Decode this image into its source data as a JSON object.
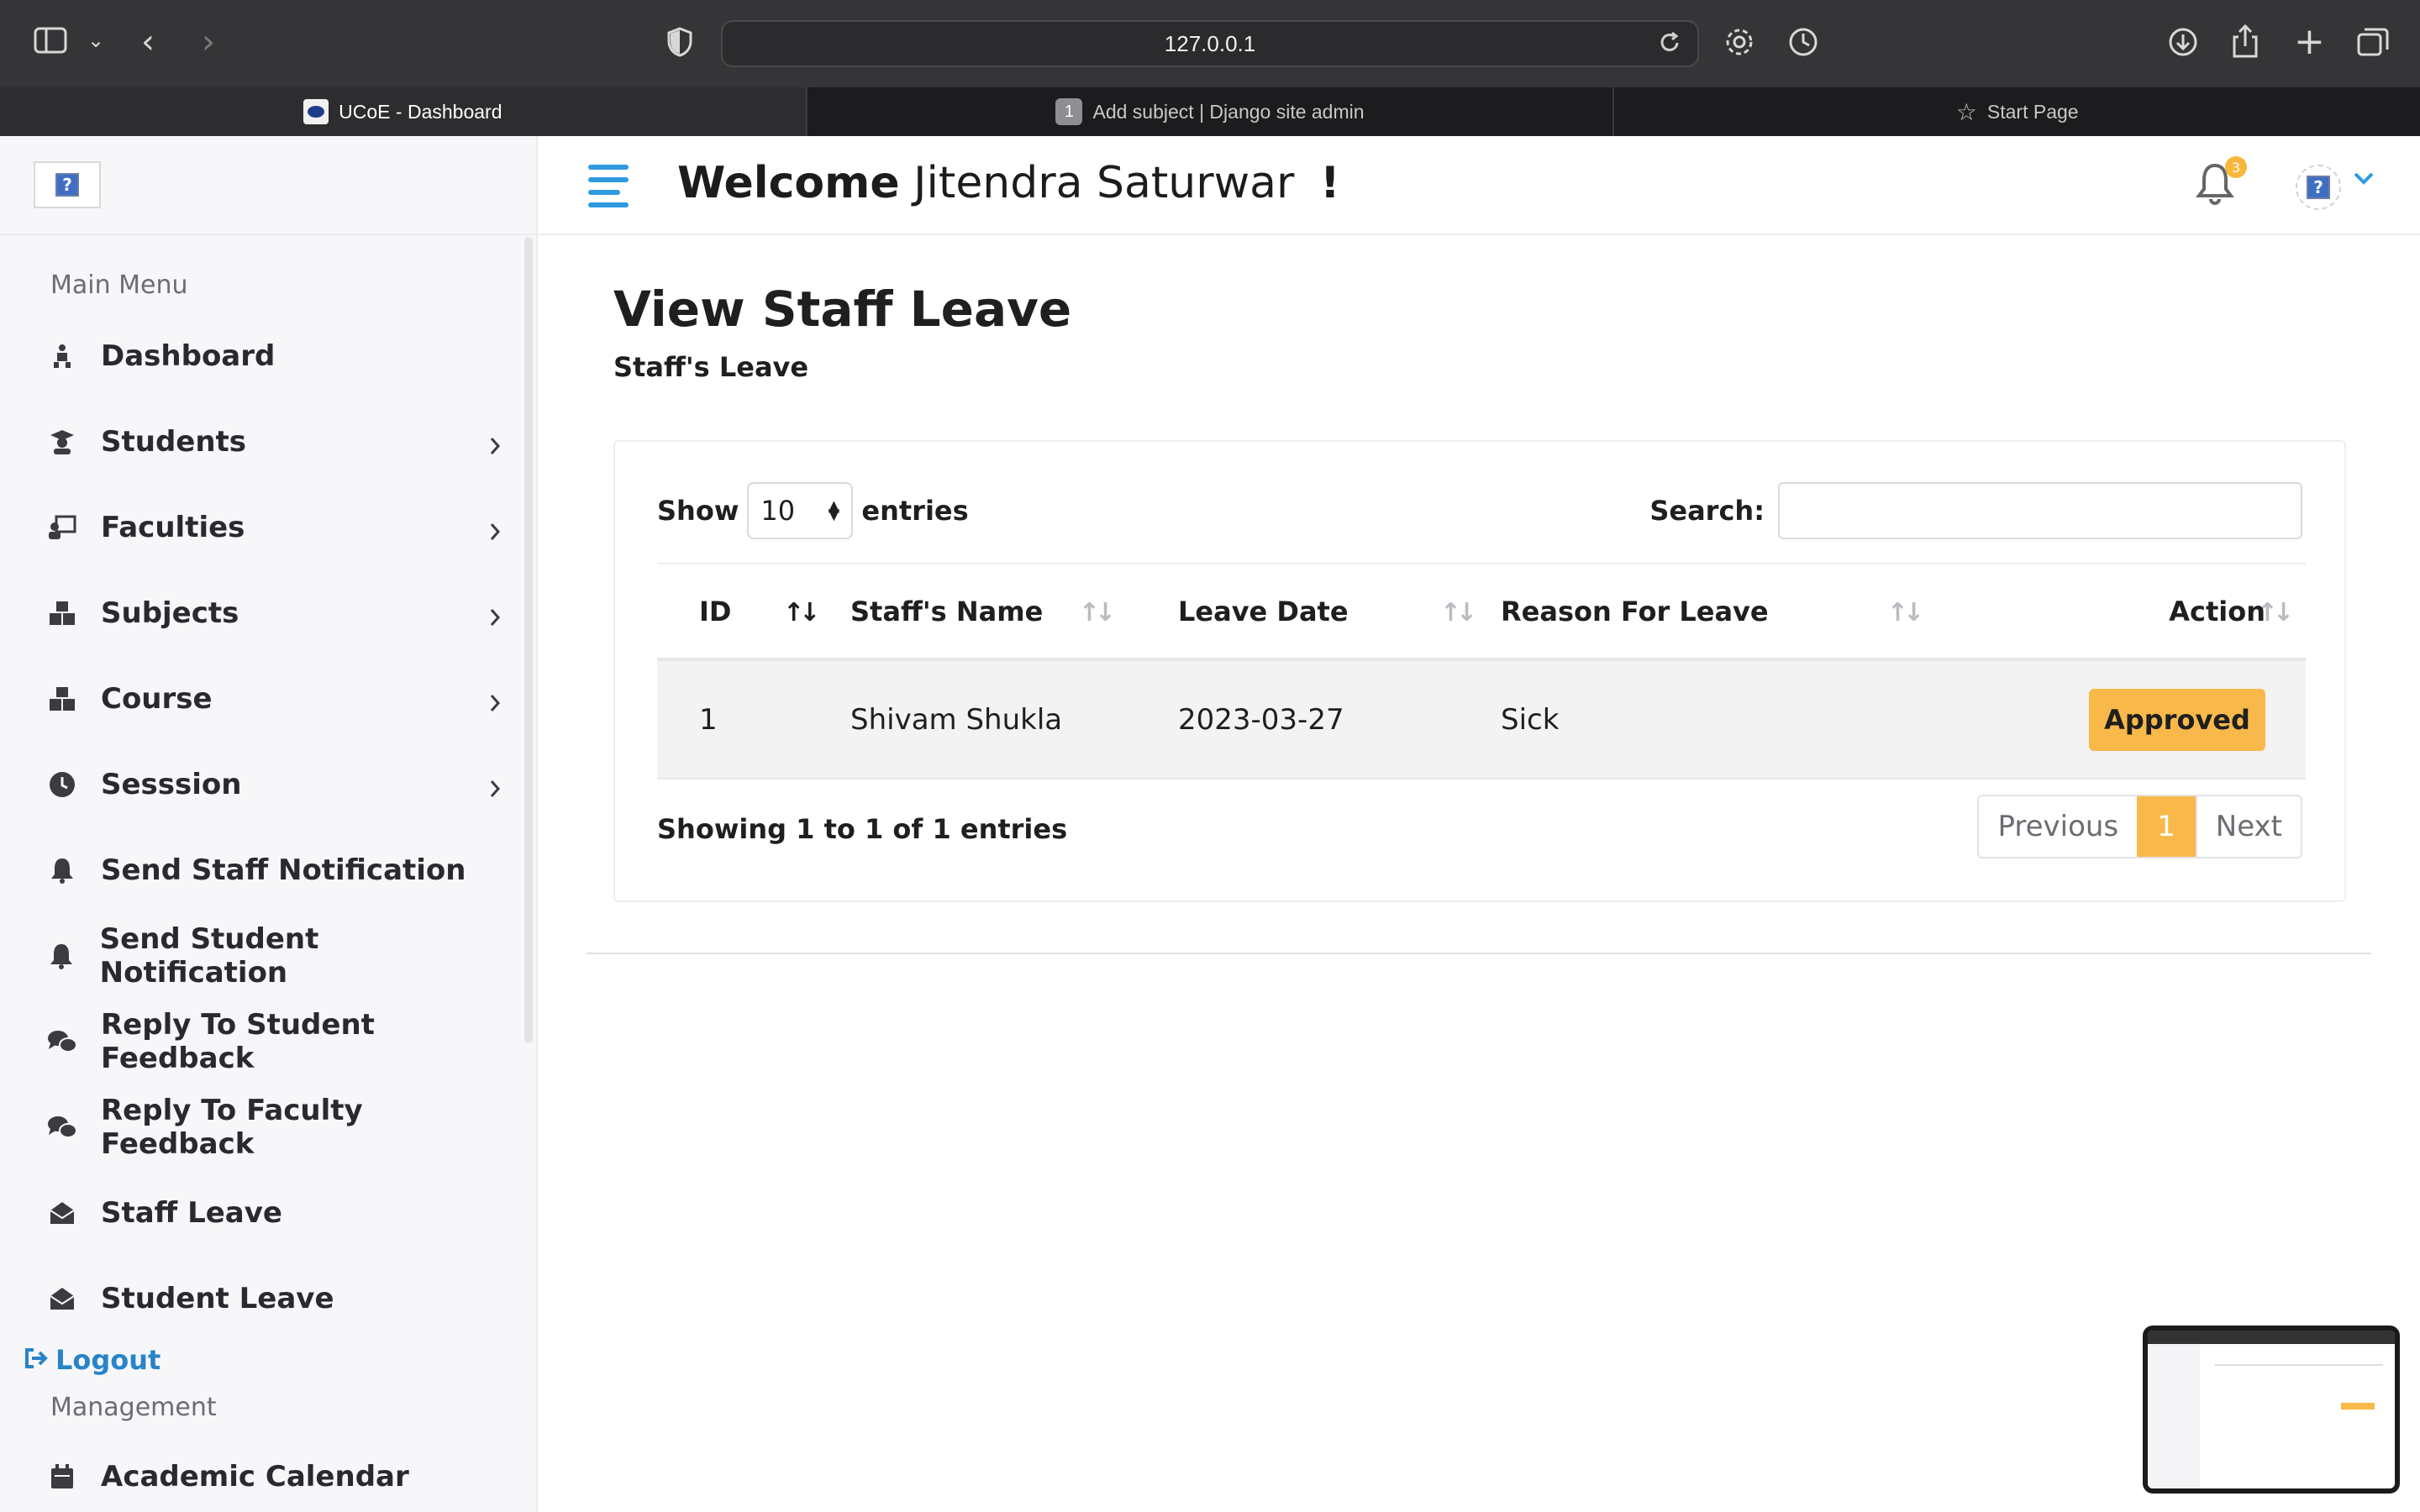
{
  "browser": {
    "url": "127.0.0.1",
    "tabs": [
      {
        "label": "UCoE - Dashboard",
        "active": true
      },
      {
        "label": "Add subject | Django site admin",
        "badge": "1"
      },
      {
        "label": "Start Page"
      }
    ]
  },
  "sidebar": {
    "logo_glyph": "?",
    "main_menu_title": "Main Menu",
    "items": [
      {
        "label": "Dashboard",
        "icon": "dashboard-icon"
      },
      {
        "label": "Students",
        "icon": "graduate-icon",
        "has_submenu": true
      },
      {
        "label": "Faculties",
        "icon": "teacher-icon",
        "has_submenu": true
      },
      {
        "label": "Subjects",
        "icon": "cubes-icon",
        "has_submenu": true
      },
      {
        "label": "Course",
        "icon": "cubes-icon",
        "has_submenu": true
      },
      {
        "label": "Sesssion",
        "icon": "clock-icon",
        "has_submenu": true
      },
      {
        "label": "Send Staff Notification",
        "icon": "bell-icon"
      },
      {
        "label": "Send Student Notification",
        "icon": "bell-icon"
      },
      {
        "label": "Reply To Student Feedback",
        "icon": "comments-icon"
      },
      {
        "label": "Reply To Faculty Feedback",
        "icon": "comments-icon"
      },
      {
        "label": "Staff Leave",
        "icon": "envelope-open-icon"
      },
      {
        "label": "Student Leave",
        "icon": "envelope-open-icon"
      }
    ],
    "logout_label": "Logout",
    "management_title": "Management",
    "management_items": [
      {
        "label": "Academic Calendar",
        "icon": "calendar-icon"
      }
    ]
  },
  "header": {
    "welcome_bold": "Welcome",
    "user_name": "Jitendra Saturwar",
    "exclaim": "!",
    "notification_count": "3",
    "avatar_glyph": "?"
  },
  "page": {
    "title": "View Staff Leave",
    "subtitle": "Staff's Leave"
  },
  "table": {
    "show_label": "Show",
    "entries_label": "entries",
    "page_length": "10",
    "search_label": "Search:",
    "search_value": "",
    "columns": [
      "ID",
      "Staff's Name",
      "Leave Date",
      "Reason For Leave",
      "Action"
    ],
    "rows": [
      {
        "id": "1",
        "name": "Shivam Shukla",
        "date": "2023-03-27",
        "reason": "Sick",
        "action": "Approved"
      }
    ],
    "info": "Showing 1 to 1 of 1 entries",
    "pagination": {
      "previous": "Previous",
      "current": "1",
      "next": "Next"
    }
  },
  "colors": {
    "accent": "#2f9ae0",
    "approved": "#f9b94a",
    "sidebar_bg": "#f7f7f9",
    "chrome": "#353537"
  }
}
